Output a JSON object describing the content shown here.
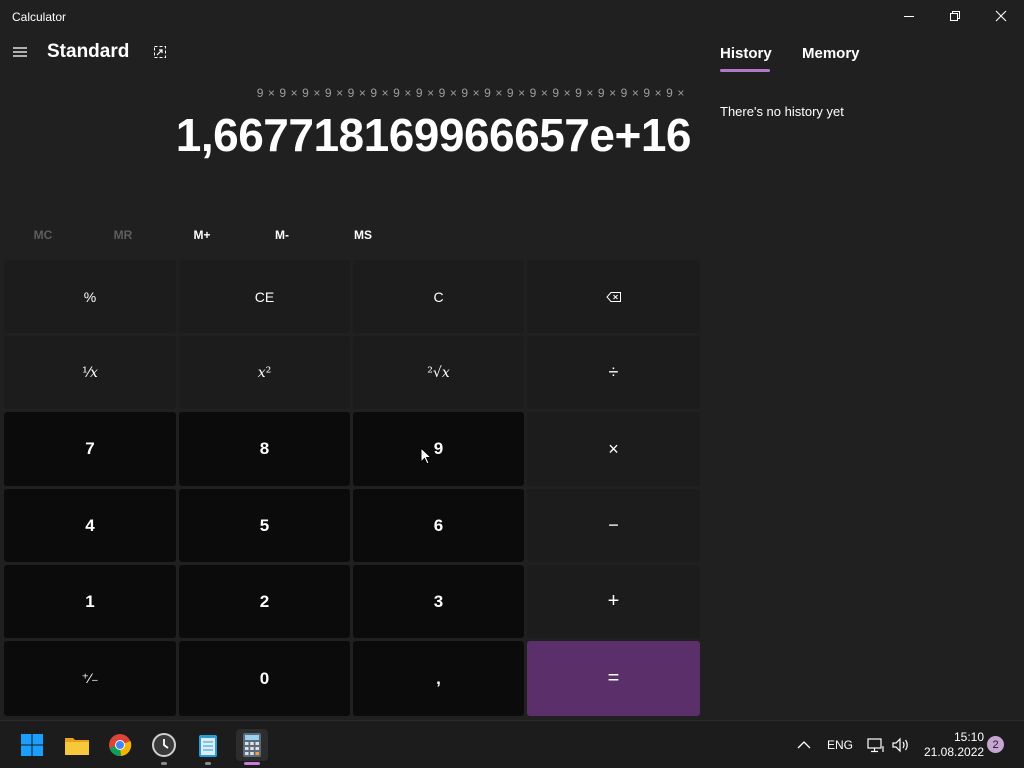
{
  "window": {
    "title": "Calculator"
  },
  "header": {
    "mode": "Standard"
  },
  "display": {
    "expression": "9 × 9 × 9 × 9 × 9 × 9 × 9 × 9 × 9 × 9 × 9 × 9 × 9 × 9 × 9 × 9 × 9 × 9 × 9 ×",
    "value": "1,66771816996 6657e+16"
  },
  "memory": [
    "MC",
    "MR",
    "M+",
    "M-",
    "MS"
  ],
  "keys": {
    "percent": "%",
    "ce": "CE",
    "c": "C",
    "reciprocal": "¹⁄𝑥",
    "square": "𝑥²",
    "sqrt": "²√𝑥",
    "divide": "÷",
    "n7": "7",
    "n8": "8",
    "n9": "9",
    "multiply": "×",
    "n4": "4",
    "n5": "5",
    "n6": "6",
    "minus": "−",
    "n1": "1",
    "n2": "2",
    "n3": "3",
    "plus": "+",
    "negate": "⁺⁄₋",
    "n0": "0",
    "decimal": ",",
    "equals": "="
  },
  "panel": {
    "tabs": [
      "History",
      "Memory"
    ],
    "active_tab": "History",
    "empty_message": "There's no history yet"
  },
  "taskbar": {
    "apps": [
      "windows-start-icon",
      "file-explorer-icon",
      "chrome-icon",
      "clock-app-icon",
      "notepad-icon",
      "calculator-icon"
    ],
    "language": "ENG",
    "time": "15:10",
    "date": "21.08.2022",
    "notifications": "2"
  },
  "colors": {
    "accent": "#5b2f69",
    "tab_underline": "#b279c9",
    "background": "#202020"
  }
}
